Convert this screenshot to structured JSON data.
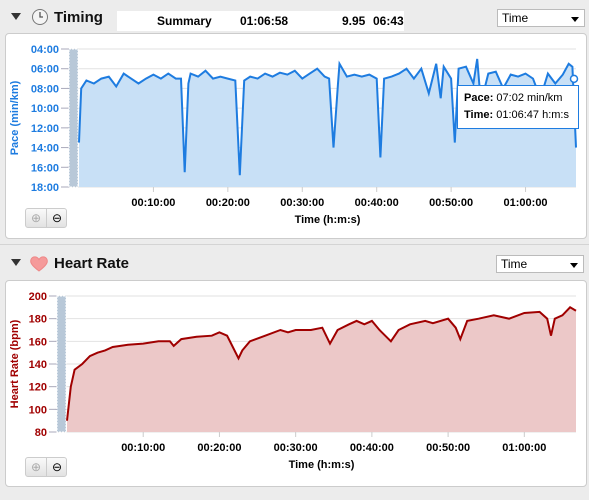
{
  "timing": {
    "title": "Timing",
    "icon": "clock-icon",
    "summary": {
      "label": "Summary",
      "time": "01:06:58",
      "distance": "9.95",
      "pace": "06:43"
    },
    "dropdown": "Time",
    "tooltip": {
      "pace_label": "Pace:",
      "pace_value": "07:02 min/km",
      "time_label": "Time:",
      "time_value": "01:06:47 h:m:s"
    }
  },
  "heart": {
    "title": "Heart Rate",
    "icon": "heart-icon",
    "dropdown": "Time"
  },
  "chart_data": [
    {
      "type": "area",
      "ylabel": "Pace (min/km)",
      "xlabel": "Time (h:m:s)",
      "color": "#1e7ce0",
      "fill": "#c8e0f6",
      "yticks": [
        "04:00",
        "06:00",
        "08:00",
        "10:00",
        "12:00",
        "14:00",
        "16:00",
        "18:00"
      ],
      "ylim": [
        4,
        18
      ],
      "y_inverted": true,
      "xticks": [
        "00:10:00",
        "00:20:00",
        "00:30:00",
        "00:40:00",
        "00:50:00",
        "01:00:00"
      ],
      "xlim_minutes": [
        0,
        66.78
      ],
      "x_minutes": [
        0,
        0.3,
        1,
        2,
        3,
        4,
        5,
        6,
        7,
        8,
        9,
        10,
        11,
        12,
        13,
        13.7,
        14.2,
        14.7,
        15,
        16,
        17,
        18,
        19,
        20,
        21,
        21.6,
        22.2,
        23,
        24,
        25,
        26,
        27,
        28,
        29,
        30,
        31,
        32,
        33,
        33.6,
        34.2,
        34.8,
        35,
        36,
        37,
        38,
        39,
        40,
        40.5,
        41,
        42,
        43,
        44,
        45,
        46,
        47,
        48,
        48.6,
        49,
        50,
        50.5,
        51,
        52,
        53,
        53.5,
        54,
        55,
        56,
        57,
        58,
        59,
        60,
        61,
        62,
        63,
        64,
        65,
        65.8,
        66.3,
        66.78
      ],
      "pace_minutes": [
        13.5,
        8,
        7.2,
        7.5,
        7,
        6.8,
        7.8,
        6.5,
        7,
        7.5,
        7,
        6.6,
        7,
        6.5,
        7,
        7,
        16.5,
        7.5,
        6.5,
        6.8,
        6.2,
        7,
        6.8,
        7,
        7.2,
        16.8,
        7.2,
        6.8,
        7,
        6.5,
        6.8,
        6.4,
        6.6,
        6.2,
        7,
        6.5,
        6,
        6.8,
        7,
        14,
        7.5,
        5.5,
        6.8,
        6.6,
        6.8,
        6.6,
        7,
        15,
        7,
        6.8,
        6.5,
        6,
        7,
        6,
        8.5,
        5.5,
        9,
        5.8,
        7,
        13.5,
        6,
        5.8,
        7.5,
        5,
        9.5,
        6.5,
        6.3,
        8,
        6.6,
        6.8,
        6.5,
        7,
        9,
        6.5,
        7.5,
        6.6,
        5.5,
        5.8,
        14
      ]
    },
    {
      "type": "area",
      "ylabel": "Heart Rate (bpm)",
      "xlabel": "Time (h:m:s)",
      "color": "#a00000",
      "fill": "#ecc8c8",
      "yticks": [
        "200",
        "180",
        "160",
        "140",
        "120",
        "100",
        "80"
      ],
      "ylim": [
        80,
        200
      ],
      "xticks": [
        "00:10:00",
        "00:20:00",
        "00:30:00",
        "00:40:00",
        "00:50:00",
        "01:00:00"
      ],
      "xlim_minutes": [
        0,
        66.78
      ],
      "x_minutes": [
        0,
        0.5,
        1,
        2,
        3,
        4,
        5,
        6,
        7,
        8,
        10,
        12,
        13.5,
        14,
        15,
        17,
        19,
        20,
        21,
        22.5,
        23,
        24,
        26,
        28,
        29,
        30,
        32,
        33.5,
        34.5,
        35.5,
        37,
        38,
        39,
        40,
        41,
        42.5,
        43.5,
        45,
        47,
        48,
        50,
        51,
        51.6,
        52.5,
        54,
        56,
        58,
        60,
        62,
        63,
        63.5,
        64,
        65,
        66,
        66.78
      ],
      "bpm": [
        90,
        120,
        135,
        140,
        147,
        150,
        152,
        155,
        156,
        157,
        158,
        160,
        160,
        156,
        162,
        164,
        165,
        168,
        165,
        145,
        152,
        160,
        165,
        170,
        168,
        170,
        170,
        172,
        158,
        170,
        175,
        178,
        175,
        178,
        170,
        160,
        170,
        175,
        178,
        176,
        180,
        172,
        162,
        178,
        180,
        183,
        180,
        185,
        186,
        180,
        165,
        180,
        183,
        190,
        187
      ]
    }
  ]
}
